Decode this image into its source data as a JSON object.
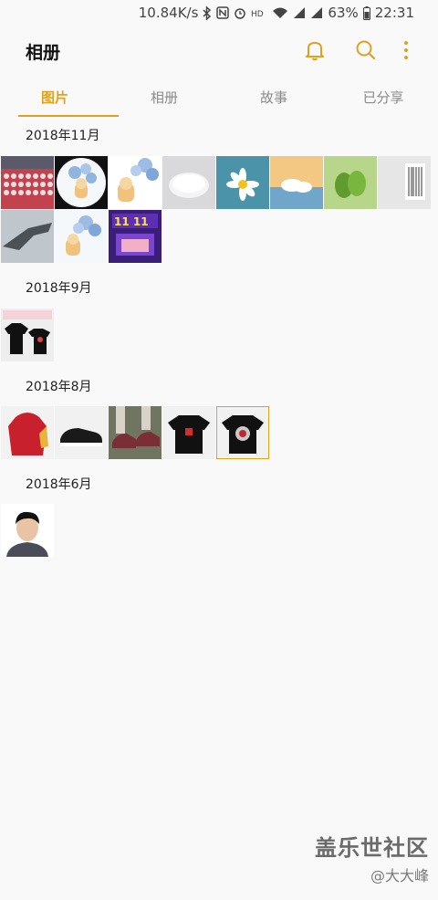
{
  "status_bar": {
    "speed": "10.84K/s",
    "battery": "63%",
    "time": "22:31",
    "icons": [
      "bluetooth-icon",
      "nfc-icon",
      "alarm-icon",
      "hd-voice-icon",
      "wifi-icon",
      "signal-icon",
      "signal-icon",
      "battery-icon"
    ]
  },
  "app_bar": {
    "title": "相册",
    "actions": [
      "bell-icon",
      "search-icon",
      "more-vert-icon"
    ],
    "accent": "#e0a21e"
  },
  "tabs": [
    {
      "label": "图片",
      "active": true
    },
    {
      "label": "相册",
      "active": false
    },
    {
      "label": "故事",
      "active": false
    },
    {
      "label": "已分享",
      "active": false
    }
  ],
  "sections": [
    {
      "label": "2018年11月",
      "thumbs": [
        "red-keyboard",
        "cartoon-bear-circle",
        "cartoon-bear-balloons",
        "white-mouse",
        "daisy-flower",
        "cloud-scene",
        "green-leaves",
        "barcode-page",
        "fighter-jet",
        "cartoon-bear-balloons-2",
        "sale-11-11-banner"
      ]
    },
    {
      "label": "2018年9月",
      "thumbs": [
        "tshirt-pair"
      ]
    },
    {
      "label": "2018年8月",
      "thumbs": [
        "red-hoodie",
        "black-sneaker",
        "sneakers-on-feet",
        "black-tshirt",
        "black-tshirt-print"
      ]
    },
    {
      "label": "2018年6月",
      "thumbs": [
        "portrait-photo"
      ]
    }
  ],
  "watermark": {
    "line1": "盖乐世社区",
    "line2": "@大大峰"
  }
}
